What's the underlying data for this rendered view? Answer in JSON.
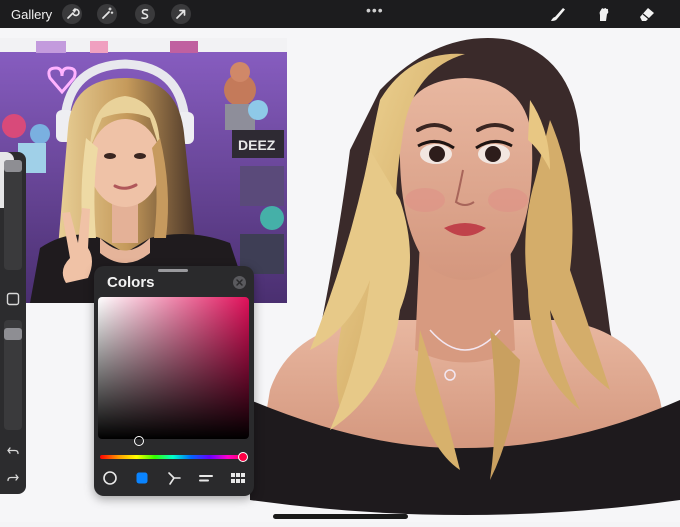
{
  "topbar": {
    "gallery_label": "Gallery",
    "left_buttons": [
      "wrench-icon",
      "magic-wand-icon",
      "selection-icon",
      "transform-arrow-icon"
    ],
    "more_label": "•••",
    "right_tools": [
      "brush-icon",
      "smudge-icon",
      "eraser-icon"
    ]
  },
  "sidebar": {
    "items": [
      "sidebar-toggle-icon",
      "brush-size-slider",
      "modify-button",
      "opacity-slider",
      "undo-icon",
      "redo-icon"
    ],
    "brush_size_level": 0.0,
    "opacity_level": 0.08
  },
  "reference_photo": {
    "sign_text": "DEEZ"
  },
  "colors_panel": {
    "title": "Colors",
    "modes": [
      "disc-icon",
      "classic-icon",
      "harmony-icon",
      "value-icon",
      "palettes-icon"
    ],
    "active_mode": "classic-icon",
    "selected_color": "#3d3237",
    "hue_color": "#e0105a",
    "hue_level": 0.97
  },
  "colors_used": {
    "toolbar_bg": "#1c1c1e",
    "panel_bg": "#2a2a2c",
    "accent_blue": "#0a84ff"
  }
}
